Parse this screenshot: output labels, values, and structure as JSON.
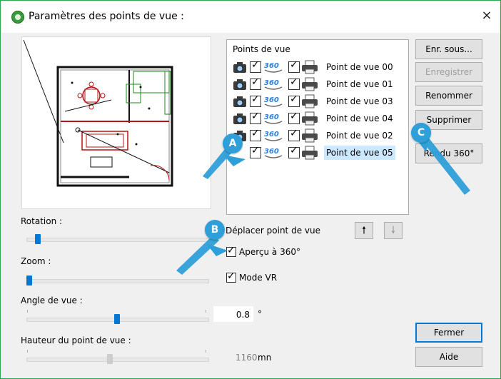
{
  "window": {
    "title": "Paramètres des points de vue :",
    "close_symbol": "×"
  },
  "list": {
    "title": "Points de vue",
    "rows": [
      {
        "label": "Point de vue 00"
      },
      {
        "label": "Point de vue 01"
      },
      {
        "label": "Point de vue 03"
      },
      {
        "label": "Point de vue 04"
      },
      {
        "label": "Point de vue 02"
      },
      {
        "label": "Point de vue 05"
      }
    ],
    "badge_360": "360"
  },
  "buttons": {
    "save_as": "Enr. sous...",
    "save": "Enregistrer",
    "rename": "Renommer",
    "delete": "Supprimer",
    "render360": "Rendu 360°",
    "close": "Fermer",
    "help": "Aide",
    "move_up": "🠕",
    "move_down": "🠗"
  },
  "controls": {
    "rotation_label": "Rotation :",
    "zoom_label": "Zoom :",
    "angle_label": "Angle de vue :",
    "angle_value": "0.8",
    "angle_unit": "°",
    "height_label": "Hauteur du point de vue :",
    "height_value": "1160",
    "height_unit": "mn",
    "move_label": "Déplacer point de vue",
    "preview360_label": "Aperçu à 360°",
    "vr_label": "Mode VR"
  },
  "callouts": {
    "a": "A",
    "b": "B",
    "c": "C"
  },
  "colors": {
    "accent": "#0078d7",
    "callout": "#2e9fd8",
    "border_green": "#2aa84a"
  }
}
